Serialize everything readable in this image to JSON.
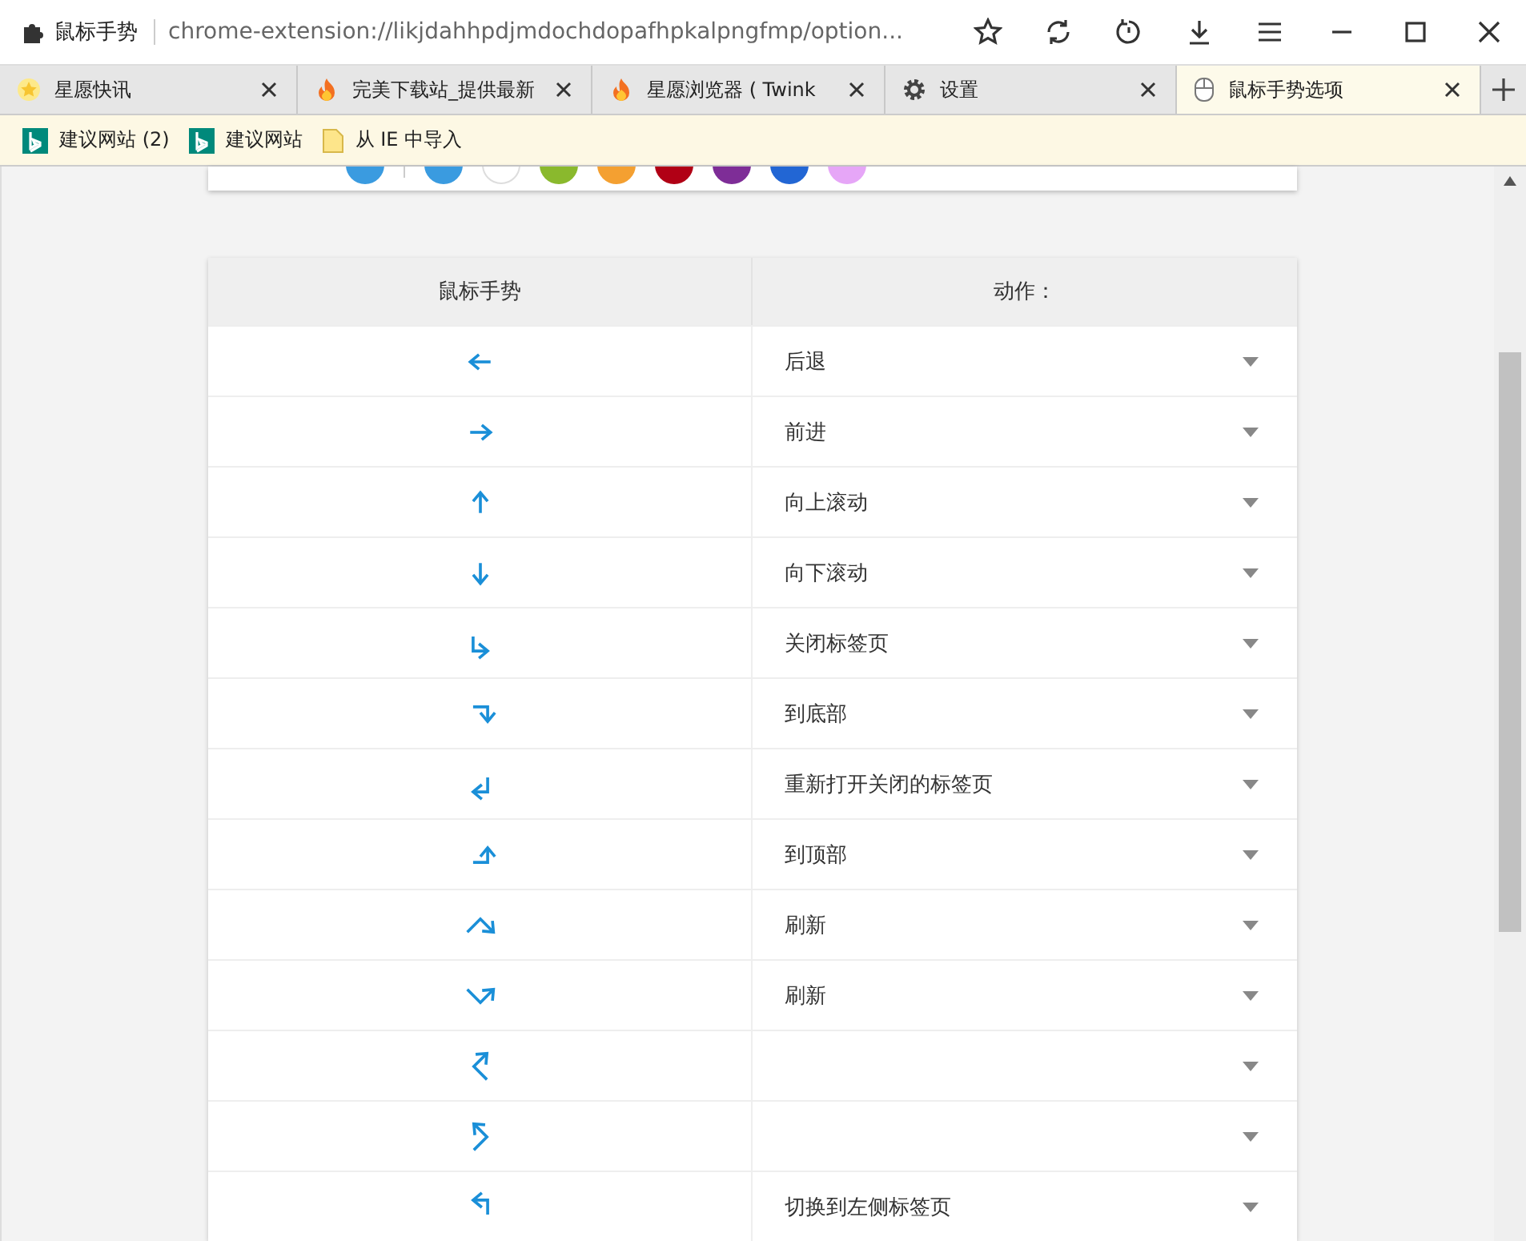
{
  "window": {
    "title": "鼠标手势",
    "url": "chrome-extension://likjdahhpdjmdochdopafhpkalpngfmp/option..."
  },
  "tabs": [
    {
      "label": "星愿快讯",
      "kind": "star",
      "selected": false
    },
    {
      "label": "完美下载站_提供最新",
      "kind": "flame",
      "selected": false
    },
    {
      "label": "星愿浏览器 ( Twink",
      "kind": "flame",
      "selected": false
    },
    {
      "label": "设置",
      "kind": "gear",
      "selected": false
    },
    {
      "label": "鼠标手势选项",
      "kind": "mouse",
      "selected": true
    }
  ],
  "bookmarks": [
    {
      "label": "建议网站 (2)",
      "kind": "bing"
    },
    {
      "label": "建议网站",
      "kind": "bing"
    },
    {
      "label": "从 IE 中导入",
      "kind": "folder"
    }
  ],
  "colors": {
    "current": {
      "color": "#3a9be0"
    },
    "swatches": [
      {
        "color": "#3a9be0"
      },
      {
        "color": "#ffffff"
      },
      {
        "color": "#8ab92d"
      },
      {
        "color": "#f4a031"
      },
      {
        "color": "#b10015"
      },
      {
        "color": "#7e2d97"
      },
      {
        "color": "#2266d4"
      },
      {
        "color": "#e6a6f7"
      }
    ]
  },
  "table": {
    "columns": [
      "鼠标手势",
      "动作："
    ],
    "rows": [
      {
        "kind": "l",
        "action": "后退"
      },
      {
        "kind": "r",
        "action": "前进"
      },
      {
        "kind": "u",
        "action": "向上滚动"
      },
      {
        "kind": "d",
        "action": "向下滚动"
      },
      {
        "kind": "d-r",
        "action": "关闭标签页"
      },
      {
        "kind": "r-d",
        "action": "到底部"
      },
      {
        "kind": "d-l",
        "action": "重新打开关闭的标签页"
      },
      {
        "kind": "r-u",
        "action": "到顶部"
      },
      {
        "kind": "ur-dr",
        "action": "刷新"
      },
      {
        "kind": "dr-ur",
        "action": "刷新"
      },
      {
        "kind": "ul-ur",
        "action": ""
      },
      {
        "kind": "ur-ul",
        "action": ""
      },
      {
        "kind": "u-l",
        "action": "切换到左侧标签页"
      }
    ]
  }
}
